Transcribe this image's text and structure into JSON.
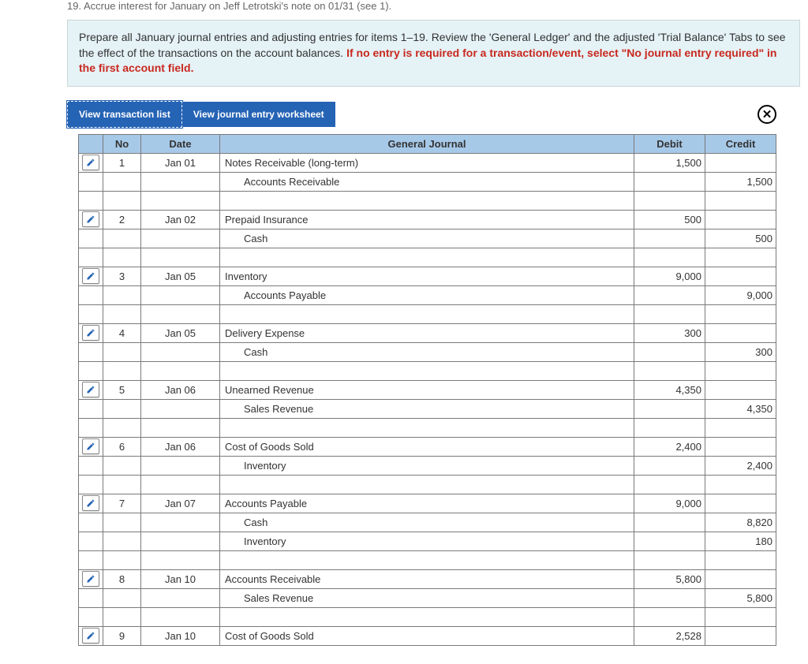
{
  "question_header": "19. Accrue interest for January on Jeff Letrotski's note on 01/31 (see 1).",
  "instruction_main": "Prepare all January journal entries and adjusting entries for items 1–19. Review the 'General Ledger' and the adjusted 'Trial Balance' Tabs to see the effect of the transactions on the account balances. ",
  "instruction_red": "If no entry is required for a transaction/event, select \"No journal entry required\" in the first account field.",
  "tabs": {
    "transaction_list": "View transaction list",
    "worksheet": "View journal entry worksheet"
  },
  "close_icon": "✕",
  "headers": {
    "no": "No",
    "date": "Date",
    "gj": "General Journal",
    "debit": "Debit",
    "credit": "Credit"
  },
  "entries": [
    {
      "no": "1",
      "date": "Jan 01",
      "lines": [
        {
          "acct": "Notes Receivable (long-term)",
          "debit": "1,500",
          "credit": "",
          "indent": "d"
        },
        {
          "acct": "Accounts Receivable",
          "debit": "",
          "credit": "1,500",
          "indent": "c"
        }
      ]
    },
    {
      "no": "2",
      "date": "Jan 02",
      "lines": [
        {
          "acct": "Prepaid Insurance",
          "debit": "500",
          "credit": "",
          "indent": "d"
        },
        {
          "acct": "Cash",
          "debit": "",
          "credit": "500",
          "indent": "c"
        }
      ]
    },
    {
      "no": "3",
      "date": "Jan 05",
      "lines": [
        {
          "acct": "Inventory",
          "debit": "9,000",
          "credit": "",
          "indent": "d"
        },
        {
          "acct": "Accounts Payable",
          "debit": "",
          "credit": "9,000",
          "indent": "c"
        }
      ]
    },
    {
      "no": "4",
      "date": "Jan 05",
      "lines": [
        {
          "acct": "Delivery Expense",
          "debit": "300",
          "credit": "",
          "indent": "d"
        },
        {
          "acct": "Cash",
          "debit": "",
          "credit": "300",
          "indent": "c"
        }
      ]
    },
    {
      "no": "5",
      "date": "Jan 06",
      "lines": [
        {
          "acct": "Unearned Revenue",
          "debit": "4,350",
          "credit": "",
          "indent": "d"
        },
        {
          "acct": "Sales Revenue",
          "debit": "",
          "credit": "4,350",
          "indent": "c"
        }
      ]
    },
    {
      "no": "6",
      "date": "Jan 06",
      "lines": [
        {
          "acct": "Cost of Goods Sold",
          "debit": "2,400",
          "credit": "",
          "indent": "d"
        },
        {
          "acct": "Inventory",
          "debit": "",
          "credit": "2,400",
          "indent": "c"
        }
      ]
    },
    {
      "no": "7",
      "date": "Jan 07",
      "lines": [
        {
          "acct": "Accounts Payable",
          "debit": "9,000",
          "credit": "",
          "indent": "d"
        },
        {
          "acct": "Cash",
          "debit": "",
          "credit": "8,820",
          "indent": "c"
        },
        {
          "acct": "Inventory",
          "debit": "",
          "credit": "180",
          "indent": "c"
        }
      ]
    },
    {
      "no": "8",
      "date": "Jan 10",
      "lines": [
        {
          "acct": "Accounts Receivable",
          "debit": "5,800",
          "credit": "",
          "indent": "d"
        },
        {
          "acct": "Sales Revenue",
          "debit": "",
          "credit": "5,800",
          "indent": "c"
        }
      ]
    },
    {
      "no": "9",
      "date": "Jan 10",
      "lines": [
        {
          "acct": "Cost of Goods Sold",
          "debit": "2,528",
          "credit": "",
          "indent": "d"
        }
      ]
    }
  ]
}
